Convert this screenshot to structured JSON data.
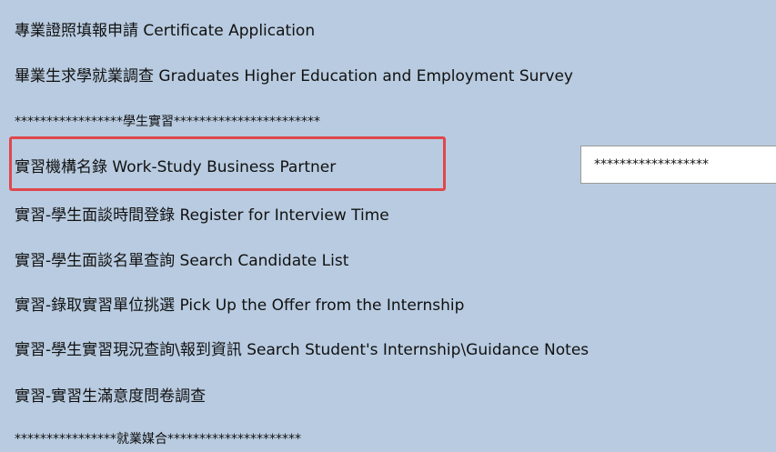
{
  "menu": {
    "items": [
      {
        "label": "專業證照填報申請 Certificate Application"
      },
      {
        "label": "畢業生求學就業調查 Graduates Higher Education and Employment Survey"
      },
      {
        "label": "*****************學生實習***********************"
      },
      {
        "label": "實習機構名錄 Work-Study Business Partner"
      },
      {
        "label": "實習-學生面談時間登錄 Register for Interview Time"
      },
      {
        "label": "實習-學生面談名單查詢 Search Candidate List"
      },
      {
        "label": "實習-錄取實習單位挑選 Pick Up the Offer from the Internship"
      },
      {
        "label": "實習-學生實習現況查詢\\報到資訊 Search Student's Internship\\Guidance Notes"
      },
      {
        "label": "實習-實習生滿意度問卷調查"
      },
      {
        "label": "****************就業媒合*********************"
      }
    ]
  },
  "side_box": {
    "text": "******************"
  },
  "colors": {
    "background": "#b8cbe0",
    "highlight": "#e0474c"
  }
}
